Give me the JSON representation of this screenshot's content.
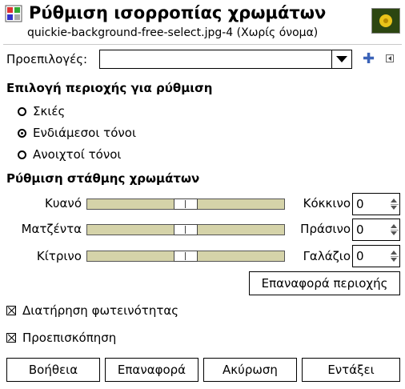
{
  "header": {
    "title": "Ρύθμιση ισορροπίας χρωμάτων",
    "subtitle": "quickie-background-free-select.jpg-4 (Χωρίς όνομα)",
    "app_icon": "color-balance-icon",
    "thumbnail": "image-thumbnail"
  },
  "presets": {
    "label": "Προεπιλογές:",
    "value": "",
    "add_icon": "plus-icon",
    "menu_icon": "menu-arrow-icon"
  },
  "range": {
    "title": "Επιλογή περιοχής για ρύθμιση",
    "options": [
      {
        "label": "Σκιές",
        "selected": false
      },
      {
        "label": "Ενδιάμεσοι τόνοι",
        "selected": true
      },
      {
        "label": "Ανοιχτοί τόνοι",
        "selected": false
      }
    ]
  },
  "levels": {
    "title": "Ρύθμιση στάθμης χρωμάτων",
    "sliders": [
      {
        "left": "Κυανό",
        "right": "Κόκκινο",
        "value": "0"
      },
      {
        "left": "Ματζέντα",
        "right": "Πράσινο",
        "value": "0"
      },
      {
        "left": "Κίτρινο",
        "right": "Γαλάζιο",
        "value": "0"
      }
    ],
    "reset_range": "Επαναφορά περιοχής"
  },
  "options": {
    "preserve_luminosity": {
      "label": "Διατήρηση φωτεινότητας",
      "checked": true
    },
    "preview": {
      "label": "Προεπισκόπηση",
      "checked": true
    }
  },
  "buttons": {
    "help": "Βοήθεια",
    "reset": "Επαναφορά",
    "cancel": "Ακύρωση",
    "ok": "Εντάξει"
  }
}
